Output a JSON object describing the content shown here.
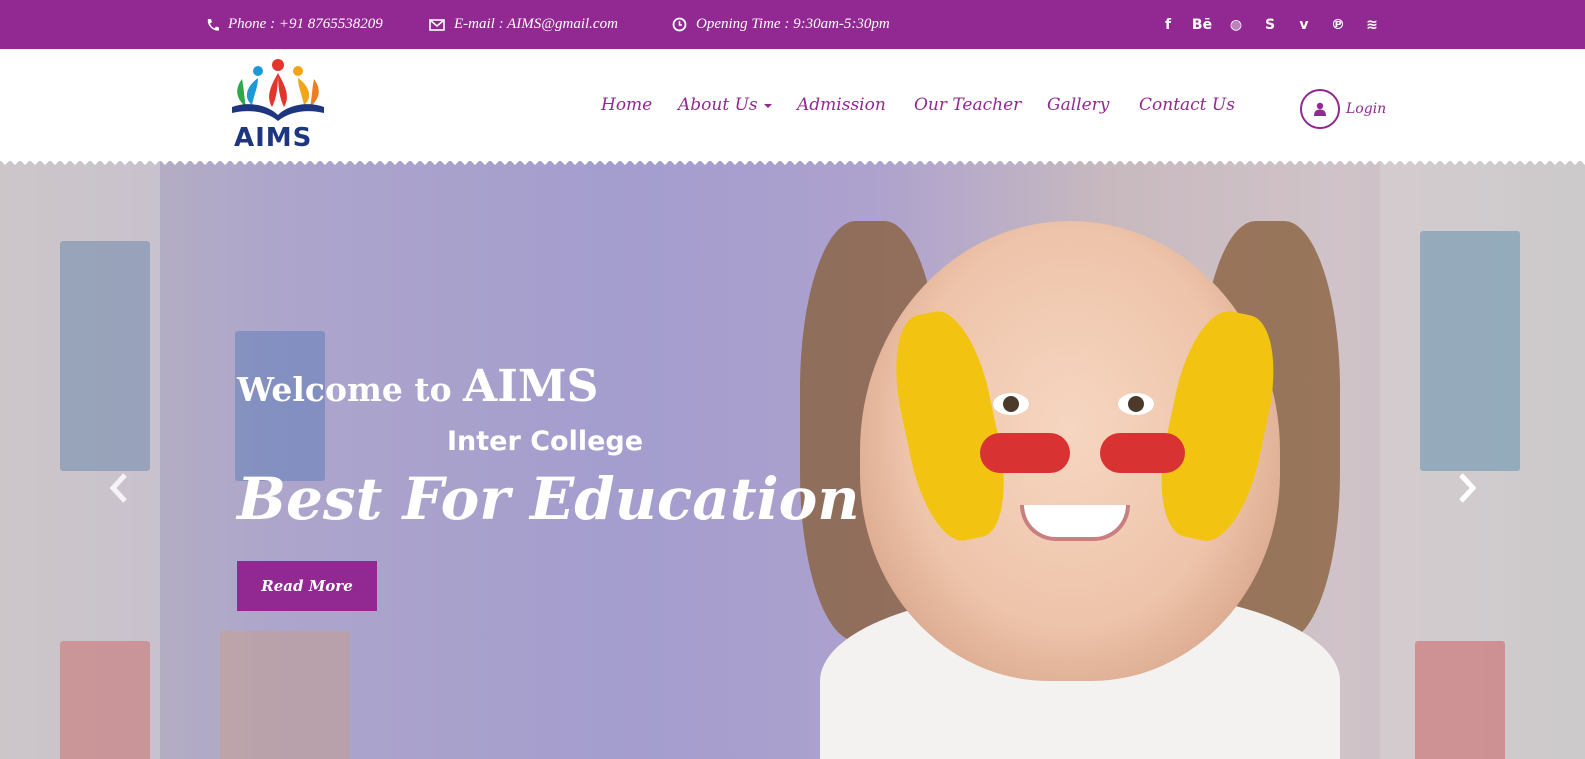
{
  "topbar": {
    "phone": "Phone : +91 8765538209",
    "email": "E-mail : AIMS@gmail.com",
    "hours": "Opening Time : 9:30am-5:30pm",
    "social_icons": [
      "facebook-icon",
      "behance-icon",
      "dribbble-icon",
      "skype-icon",
      "vimeo-icon",
      "pinterest-icon",
      "rss-icon"
    ],
    "social_glyphs": [
      "f",
      "Bē",
      "◍",
      "S",
      "v",
      "℗",
      "≋"
    ]
  },
  "header": {
    "logo_text": "AIMS",
    "nav": [
      "Home",
      "About Us",
      "Admission",
      "Our Teacher",
      "Gallery",
      "Contact Us"
    ],
    "login": "Login"
  },
  "hero": {
    "welcome_prefix": "Welcome to",
    "welcome_brand": "AIMS",
    "subtitle": "Inter College",
    "headline": "Best For Education",
    "button": "Read More"
  },
  "colors": {
    "brand": "#922891",
    "logo_blue": "#1e3680"
  }
}
